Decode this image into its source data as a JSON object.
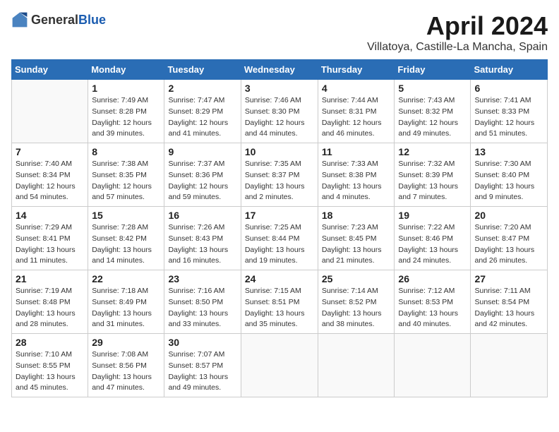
{
  "header": {
    "logo_general": "General",
    "logo_blue": "Blue",
    "month_title": "April 2024",
    "location": "Villatoya, Castille-La Mancha, Spain"
  },
  "weekdays": [
    "Sunday",
    "Monday",
    "Tuesday",
    "Wednesday",
    "Thursday",
    "Friday",
    "Saturday"
  ],
  "weeks": [
    [
      {
        "day": "",
        "sunrise": "",
        "sunset": "",
        "daylight": ""
      },
      {
        "day": "1",
        "sunrise": "Sunrise: 7:49 AM",
        "sunset": "Sunset: 8:28 PM",
        "daylight": "Daylight: 12 hours and 39 minutes."
      },
      {
        "day": "2",
        "sunrise": "Sunrise: 7:47 AM",
        "sunset": "Sunset: 8:29 PM",
        "daylight": "Daylight: 12 hours and 41 minutes."
      },
      {
        "day": "3",
        "sunrise": "Sunrise: 7:46 AM",
        "sunset": "Sunset: 8:30 PM",
        "daylight": "Daylight: 12 hours and 44 minutes."
      },
      {
        "day": "4",
        "sunrise": "Sunrise: 7:44 AM",
        "sunset": "Sunset: 8:31 PM",
        "daylight": "Daylight: 12 hours and 46 minutes."
      },
      {
        "day": "5",
        "sunrise": "Sunrise: 7:43 AM",
        "sunset": "Sunset: 8:32 PM",
        "daylight": "Daylight: 12 hours and 49 minutes."
      },
      {
        "day": "6",
        "sunrise": "Sunrise: 7:41 AM",
        "sunset": "Sunset: 8:33 PM",
        "daylight": "Daylight: 12 hours and 51 minutes."
      }
    ],
    [
      {
        "day": "7",
        "sunrise": "Sunrise: 7:40 AM",
        "sunset": "Sunset: 8:34 PM",
        "daylight": "Daylight: 12 hours and 54 minutes."
      },
      {
        "day": "8",
        "sunrise": "Sunrise: 7:38 AM",
        "sunset": "Sunset: 8:35 PM",
        "daylight": "Daylight: 12 hours and 57 minutes."
      },
      {
        "day": "9",
        "sunrise": "Sunrise: 7:37 AM",
        "sunset": "Sunset: 8:36 PM",
        "daylight": "Daylight: 12 hours and 59 minutes."
      },
      {
        "day": "10",
        "sunrise": "Sunrise: 7:35 AM",
        "sunset": "Sunset: 8:37 PM",
        "daylight": "Daylight: 13 hours and 2 minutes."
      },
      {
        "day": "11",
        "sunrise": "Sunrise: 7:33 AM",
        "sunset": "Sunset: 8:38 PM",
        "daylight": "Daylight: 13 hours and 4 minutes."
      },
      {
        "day": "12",
        "sunrise": "Sunrise: 7:32 AM",
        "sunset": "Sunset: 8:39 PM",
        "daylight": "Daylight: 13 hours and 7 minutes."
      },
      {
        "day": "13",
        "sunrise": "Sunrise: 7:30 AM",
        "sunset": "Sunset: 8:40 PM",
        "daylight": "Daylight: 13 hours and 9 minutes."
      }
    ],
    [
      {
        "day": "14",
        "sunrise": "Sunrise: 7:29 AM",
        "sunset": "Sunset: 8:41 PM",
        "daylight": "Daylight: 13 hours and 11 minutes."
      },
      {
        "day": "15",
        "sunrise": "Sunrise: 7:28 AM",
        "sunset": "Sunset: 8:42 PM",
        "daylight": "Daylight: 13 hours and 14 minutes."
      },
      {
        "day": "16",
        "sunrise": "Sunrise: 7:26 AM",
        "sunset": "Sunset: 8:43 PM",
        "daylight": "Daylight: 13 hours and 16 minutes."
      },
      {
        "day": "17",
        "sunrise": "Sunrise: 7:25 AM",
        "sunset": "Sunset: 8:44 PM",
        "daylight": "Daylight: 13 hours and 19 minutes."
      },
      {
        "day": "18",
        "sunrise": "Sunrise: 7:23 AM",
        "sunset": "Sunset: 8:45 PM",
        "daylight": "Daylight: 13 hours and 21 minutes."
      },
      {
        "day": "19",
        "sunrise": "Sunrise: 7:22 AM",
        "sunset": "Sunset: 8:46 PM",
        "daylight": "Daylight: 13 hours and 24 minutes."
      },
      {
        "day": "20",
        "sunrise": "Sunrise: 7:20 AM",
        "sunset": "Sunset: 8:47 PM",
        "daylight": "Daylight: 13 hours and 26 minutes."
      }
    ],
    [
      {
        "day": "21",
        "sunrise": "Sunrise: 7:19 AM",
        "sunset": "Sunset: 8:48 PM",
        "daylight": "Daylight: 13 hours and 28 minutes."
      },
      {
        "day": "22",
        "sunrise": "Sunrise: 7:18 AM",
        "sunset": "Sunset: 8:49 PM",
        "daylight": "Daylight: 13 hours and 31 minutes."
      },
      {
        "day": "23",
        "sunrise": "Sunrise: 7:16 AM",
        "sunset": "Sunset: 8:50 PM",
        "daylight": "Daylight: 13 hours and 33 minutes."
      },
      {
        "day": "24",
        "sunrise": "Sunrise: 7:15 AM",
        "sunset": "Sunset: 8:51 PM",
        "daylight": "Daylight: 13 hours and 35 minutes."
      },
      {
        "day": "25",
        "sunrise": "Sunrise: 7:14 AM",
        "sunset": "Sunset: 8:52 PM",
        "daylight": "Daylight: 13 hours and 38 minutes."
      },
      {
        "day": "26",
        "sunrise": "Sunrise: 7:12 AM",
        "sunset": "Sunset: 8:53 PM",
        "daylight": "Daylight: 13 hours and 40 minutes."
      },
      {
        "day": "27",
        "sunrise": "Sunrise: 7:11 AM",
        "sunset": "Sunset: 8:54 PM",
        "daylight": "Daylight: 13 hours and 42 minutes."
      }
    ],
    [
      {
        "day": "28",
        "sunrise": "Sunrise: 7:10 AM",
        "sunset": "Sunset: 8:55 PM",
        "daylight": "Daylight: 13 hours and 45 minutes."
      },
      {
        "day": "29",
        "sunrise": "Sunrise: 7:08 AM",
        "sunset": "Sunset: 8:56 PM",
        "daylight": "Daylight: 13 hours and 47 minutes."
      },
      {
        "day": "30",
        "sunrise": "Sunrise: 7:07 AM",
        "sunset": "Sunset: 8:57 PM",
        "daylight": "Daylight: 13 hours and 49 minutes."
      },
      {
        "day": "",
        "sunrise": "",
        "sunset": "",
        "daylight": ""
      },
      {
        "day": "",
        "sunrise": "",
        "sunset": "",
        "daylight": ""
      },
      {
        "day": "",
        "sunrise": "",
        "sunset": "",
        "daylight": ""
      },
      {
        "day": "",
        "sunrise": "",
        "sunset": "",
        "daylight": ""
      }
    ]
  ]
}
